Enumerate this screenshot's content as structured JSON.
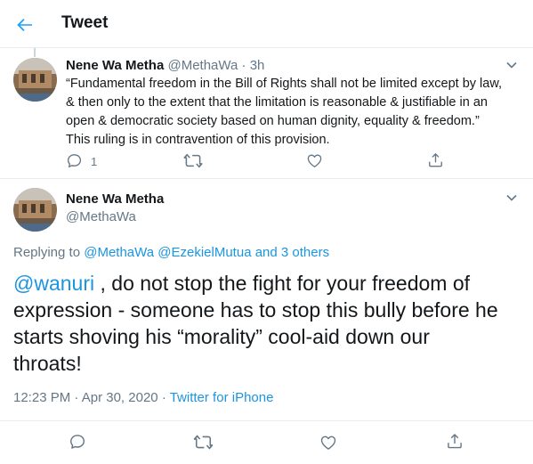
{
  "header": {
    "title": "Tweet"
  },
  "tweet1": {
    "name": "Nene Wa Metha",
    "handle": "@MethaWa",
    "dot": "·",
    "time": "3h",
    "lines": [
      "“Fundamental freedom in the Bill of Rights shall not be limited except by law,",
      "& then only to the extent that the limitation is reasonable & justifiable in an",
      "open & democratic society based on human dignity, equality & freedom.”",
      "This ruling is in contravention of this provision."
    ],
    "reply_count": "1"
  },
  "tweet2": {
    "name": "Nene Wa Metha",
    "handle": "@MethaWa",
    "replying_prefix": "Replying to",
    "replying_user1": "@MethaWa",
    "replying_user2": "@EzekielMutua",
    "replying_others": "and 3 others",
    "mention": "@wanuri",
    "lines": [
      " , do not stop the fight for your freedom of",
      "expression - someone has to stop this bully before he",
      "starts shoving his “morality” cool-aid down our",
      "throats!"
    ],
    "time": "12:23 PM",
    "sep": "·",
    "date": "Apr 30, 2020",
    "sep2": "·",
    "source": "Twitter for iPhone"
  },
  "colors": {
    "accent": "#1da1f2",
    "link": "#1b95e0",
    "text": "#14171a",
    "secondary": "#657786",
    "border": "#e6ecf0"
  },
  "icons": {
    "back": "arrow-left-icon",
    "caret": "chevron-down-icon",
    "reply": "reply-icon",
    "retweet": "retweet-icon",
    "like": "heart-icon",
    "share": "share-icon"
  }
}
